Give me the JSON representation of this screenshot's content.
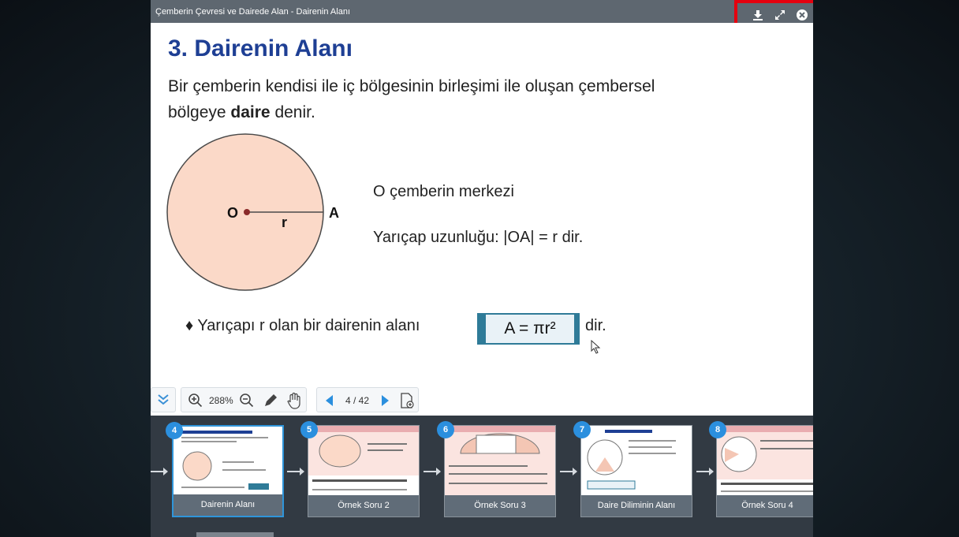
{
  "window": {
    "title": "Çemberin Çevresi ve Dairede Alan - Dairenin Alanı",
    "buttons": [
      "download-icon",
      "fullscreen-icon",
      "close-icon"
    ]
  },
  "slide": {
    "heading": "3. Dairenin Alanı",
    "intro_pre": "Bir çemberin kendisi ile iç bölgesinin birleşimi ile oluşan çembersel bölgeye ",
    "intro_bold": "daire",
    "intro_post": " denir.",
    "label_O": "O",
    "label_r": "r",
    "label_A": "A",
    "line1": "O çemberin merkezi",
    "line2": "Yarıçap uzunluğu: |OA| = r dir.",
    "bullet": "♦  Yarıçapı r olan bir dairenin alanı",
    "formula": "A = πr²",
    "formula_suffix": "dir."
  },
  "toolbar": {
    "zoom": "288%",
    "page": "4 / 42"
  },
  "thumbnails": [
    {
      "num": "4",
      "caption": "Dairenin Alanı",
      "active": true
    },
    {
      "num": "5",
      "caption": "Örnek Soru 2",
      "active": false
    },
    {
      "num": "6",
      "caption": "Örnek Soru 3",
      "active": false
    },
    {
      "num": "7",
      "caption": "Daire Diliminin Alanı",
      "active": false
    },
    {
      "num": "8",
      "caption": "Örnek Soru 4",
      "active": false
    }
  ],
  "colors": {
    "accent": "#1e3f94",
    "highlight": "#e5000f",
    "circle_fill": "#fbd9c8"
  }
}
